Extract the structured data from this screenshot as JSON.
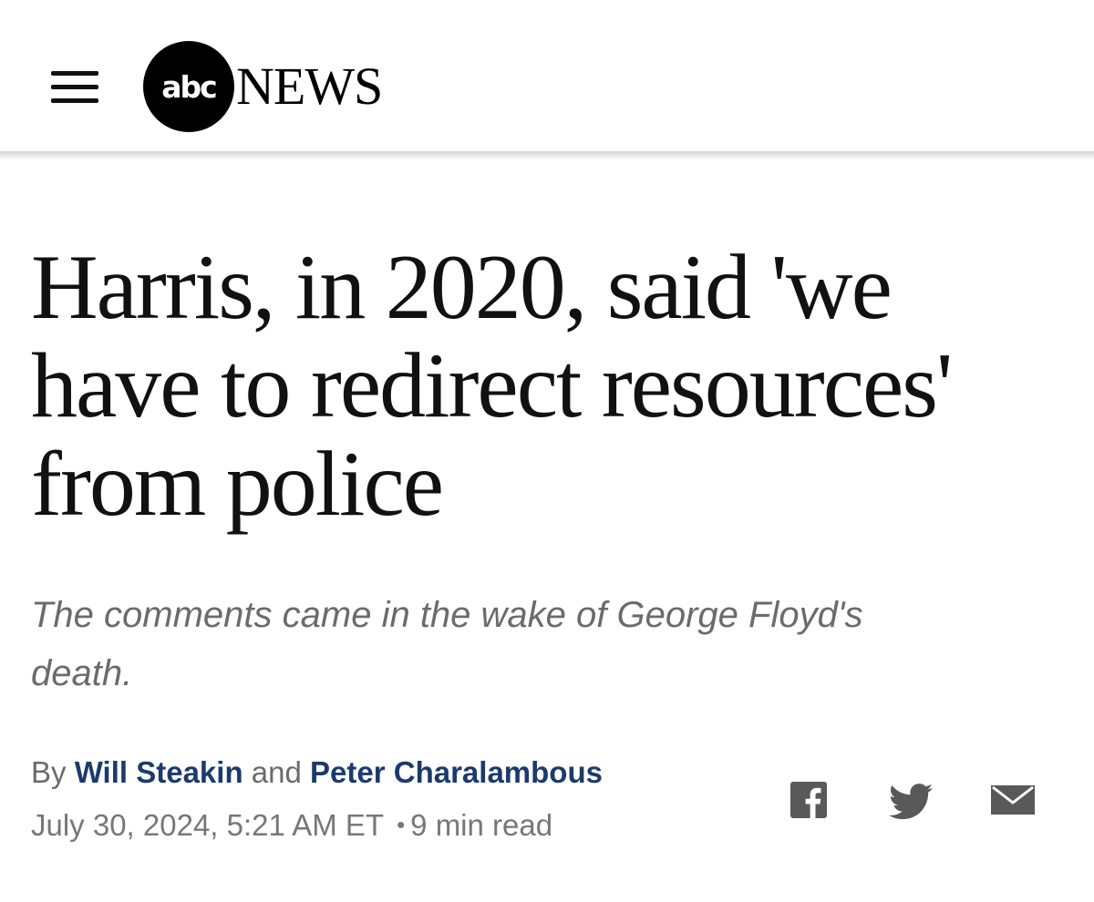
{
  "header": {
    "menu_icon": "hamburger-menu-icon",
    "logo_abc": "abc",
    "logo_news": "NEWS"
  },
  "article": {
    "headline_lines": [
      "Harris, in 2020, said 'we",
      "have to redirect resources'",
      "from police"
    ],
    "subhead_lines": [
      "The comments came in the wake of George Floyd's",
      "death."
    ],
    "byline": {
      "prefix": "By",
      "author_1": "Will Steakin",
      "conjunction": "and",
      "author_2": "Peter Charalambous"
    },
    "date": "July 30, 2024, 5:21 AM ET",
    "separator": "•",
    "read_time": "9 min read"
  },
  "share": {
    "facebook_icon": "facebook-icon",
    "twitter_icon": "twitter-icon",
    "email_icon": "email-icon"
  },
  "colors": {
    "author_link": "#1b3a6e",
    "meta_text": "#6b6b6b",
    "icon_gray": "#595959"
  }
}
